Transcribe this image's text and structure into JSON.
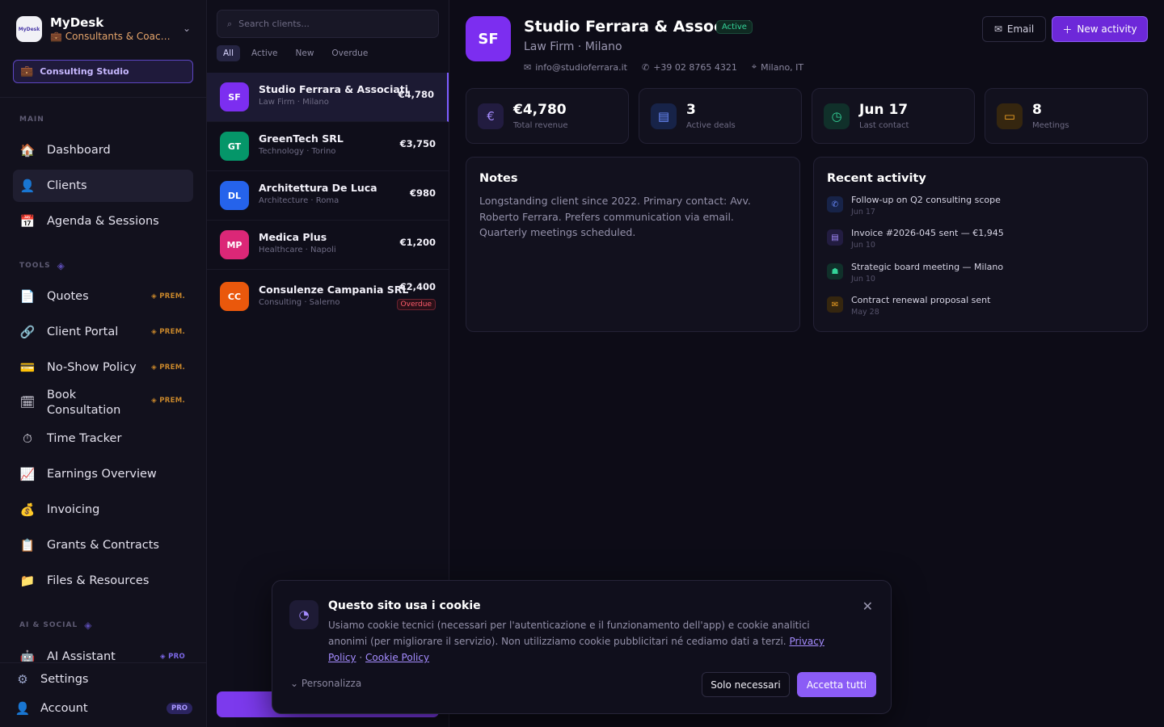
{
  "brand": {
    "name": "MyDesk",
    "logo_text": "MyDesk",
    "subtitle": "💼 Consultants & Coach..."
  },
  "workspace": {
    "label": "Consulting Studio"
  },
  "sidebar": {
    "sections": {
      "main": "MAIN",
      "tools": "TOOLS",
      "ai_social": "AI & SOCIAL"
    },
    "main_items": [
      {
        "label": "Dashboard",
        "icon": "house-icon"
      },
      {
        "label": "Clients",
        "icon": "person-icon"
      },
      {
        "label": "Agenda & Sessions",
        "icon": "calendar-icon"
      }
    ],
    "tool_items": [
      {
        "label": "Quotes",
        "badge": "PREM."
      },
      {
        "label": "Client Portal",
        "badge": "PREM."
      },
      {
        "label": "No-Show Policy",
        "badge": "PREM."
      },
      {
        "label": "Book Consultation",
        "badge": "PREM."
      },
      {
        "label": "Time Tracker"
      },
      {
        "label": "Earnings Overview"
      },
      {
        "label": "Invoicing"
      },
      {
        "label": "Grants & Contracts"
      },
      {
        "label": "Files & Resources"
      }
    ],
    "ai_items": [
      {
        "label": "AI Assistant",
        "badge": "PRO"
      }
    ],
    "settings": "Settings",
    "account": "Account",
    "account_badge": "PRO"
  },
  "client_list": {
    "search_placeholder": "Search clients...",
    "filters": [
      "All",
      "Active",
      "New",
      "Overdue"
    ],
    "clients": [
      {
        "initials": "SF",
        "name": "Studio Ferrara & Associati",
        "meta": "Law Firm · Milano",
        "amount": "€4,780",
        "color": "#7c2ef0"
      },
      {
        "initials": "GT",
        "name": "GreenTech SRL",
        "meta": "Technology · Torino",
        "amount": "€3,750",
        "color": "#059669"
      },
      {
        "initials": "DL",
        "name": "Architettura De Luca",
        "meta": "Architecture · Roma",
        "amount": "€980",
        "color": "#2563eb"
      },
      {
        "initials": "MP",
        "name": "Medica Plus",
        "meta": "Healthcare · Napoli",
        "amount": "€1,200",
        "color": "#db2777"
      },
      {
        "initials": "CC",
        "name": "Consulenze Campania SRL",
        "meta": "Consulting · Salerno",
        "amount": "€2,400",
        "status": "Overdue",
        "color": "#ea580c"
      }
    ]
  },
  "detail": {
    "initials": "SF",
    "name": "Studio Ferrara & Associati",
    "status": "Active",
    "subtitle": "Law Firm · Milano",
    "email": "info@studioferrara.it",
    "phone": "+39 02 8765 4321",
    "location": "Milano, IT",
    "email_button": "Email",
    "new_activity_button": "New activity",
    "stats": [
      {
        "value": "€4,780",
        "label": "Total revenue",
        "icon": "euro-icon"
      },
      {
        "value": "3",
        "label": "Active deals",
        "icon": "document-icon"
      },
      {
        "value": "Jun 17",
        "label": "Last contact",
        "icon": "clock-icon"
      },
      {
        "value": "8",
        "label": "Meetings",
        "icon": "chat-icon"
      }
    ],
    "notes_title": "Notes",
    "notes": "Longstanding client since 2022. Primary contact: Avv. Roberto Ferrara. Prefers communication via email. Quarterly meetings scheduled.",
    "activity_title": "Recent activity",
    "activities": [
      {
        "text": "Follow-up on Q2 consulting scope",
        "date": "Jun 17",
        "icon": "phone-icon"
      },
      {
        "text": "Invoice #2026-045 sent — €1,945",
        "date": "Jun 10",
        "icon": "document-icon"
      },
      {
        "text": "Strategic board meeting — Milano",
        "date": "Jun 10",
        "icon": "people-icon"
      },
      {
        "text": "Contract renewal proposal sent",
        "date": "May 28",
        "icon": "mail-icon"
      }
    ]
  },
  "cookie": {
    "title": "Questo sito usa i cookie",
    "body": "Usiamo cookie tecnici (necessari per l'autenticazione e il funzionamento dell'app) e cookie analitici anonimi (per migliorare il servizio). Non utilizziamo cookie pubblicitari né cediamo dati a terzi.",
    "privacy_link": "Privacy Policy",
    "separator": "·",
    "cookie_link": "Cookie Policy",
    "customize": "Personalizza",
    "necessary_button": "Solo necessari",
    "accept_button": "Accetta tutti"
  }
}
